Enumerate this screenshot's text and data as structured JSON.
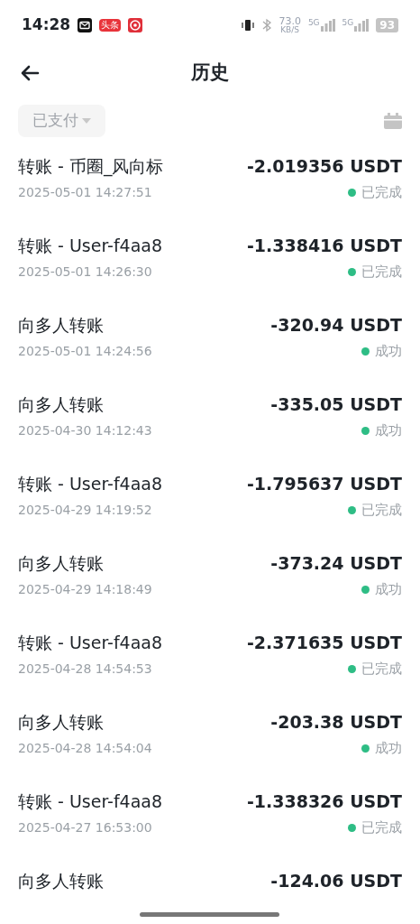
{
  "status_bar": {
    "time": "14:28",
    "badge": "头条",
    "speed": "73.0",
    "speed_unit": "KB/S",
    "network_1": "5G",
    "network_2": "5G",
    "battery": "93"
  },
  "header": {
    "title": "历史"
  },
  "filter": {
    "label": "已支付"
  },
  "transactions": [
    {
      "title": "转账 - 币圈_风向标",
      "date": "2025-05-01 14:27:51",
      "amount": "-2.019356 USDT",
      "status": "已完成"
    },
    {
      "title": "转账 - User-f4aa8",
      "date": "2025-05-01 14:26:30",
      "amount": "-1.338416 USDT",
      "status": "已完成"
    },
    {
      "title": "向多人转账",
      "date": "2025-05-01 14:24:56",
      "amount": "-320.94 USDT",
      "status": "成功"
    },
    {
      "title": "向多人转账",
      "date": "2025-04-30 14:12:43",
      "amount": "-335.05 USDT",
      "status": "成功"
    },
    {
      "title": "转账 - User-f4aa8",
      "date": "2025-04-29 14:19:52",
      "amount": "-1.795637 USDT",
      "status": "已完成"
    },
    {
      "title": "向多人转账",
      "date": "2025-04-29 14:18:49",
      "amount": "-373.24 USDT",
      "status": "成功"
    },
    {
      "title": "转账 - User-f4aa8",
      "date": "2025-04-28 14:54:53",
      "amount": "-2.371635 USDT",
      "status": "已完成"
    },
    {
      "title": "向多人转账",
      "date": "2025-04-28 14:54:04",
      "amount": "-203.38 USDT",
      "status": "成功"
    },
    {
      "title": "转账 - User-f4aa8",
      "date": "2025-04-27 16:53:00",
      "amount": "-1.338326 USDT",
      "status": "已完成"
    },
    {
      "title": "向多人转账",
      "amount": "-124.06 USDT"
    }
  ]
}
